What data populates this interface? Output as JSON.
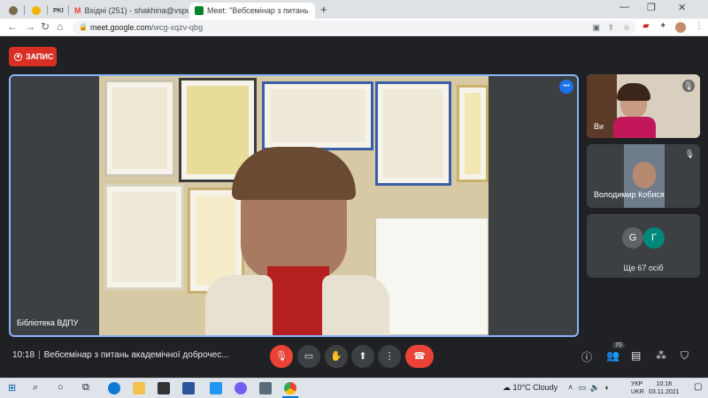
{
  "browser": {
    "tabs": [
      {
        "label": "",
        "favicon_color": "#7b6b4a"
      },
      {
        "label": "",
        "favicon_color": "#f0b400"
      },
      {
        "label": "PKI",
        "favicon_color": "#ffffff"
      },
      {
        "label": "Вхідні (251) - shakhina@vspu.edu",
        "favicon_color": "#ea4335"
      },
      {
        "label": "Meet: \"Вебсемінар з питань",
        "favicon_color": "#00832d"
      }
    ],
    "new_tab_label": "+",
    "url_host": "meet.google.com",
    "url_path": "/wcg-xqzv-qbg"
  },
  "meet": {
    "record_label": "ЗАПИС",
    "main_speaker_name": "Бібліотека ВДПУ",
    "self_label": "Ви",
    "participant_name": "Володимир Кобися",
    "avatar_letters": [
      "G",
      "Г"
    ],
    "avatar_colors": [
      "#5f6368",
      "#00897b"
    ],
    "others_count": "Ще 67 осіб",
    "time": "10:18",
    "meeting_title": "Вебсемінар з питань академічної доброчес...",
    "people_count": "70"
  },
  "taskbar": {
    "weather": "10°C  Cloudy",
    "lang_top": "УКР",
    "lang_bottom": "UKR",
    "clock_time": "10:18",
    "clock_date": "03.11.2021"
  }
}
